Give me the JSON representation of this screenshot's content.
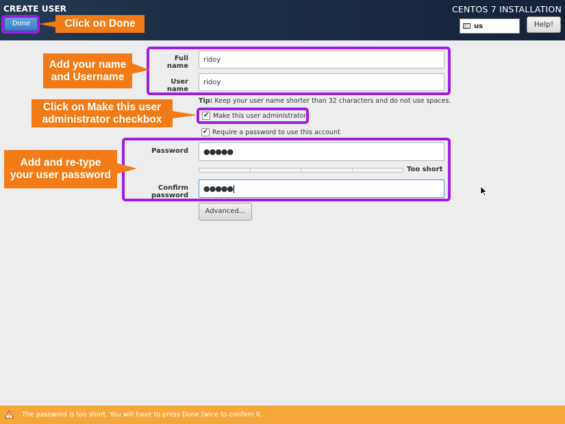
{
  "header": {
    "spoke_title": "CREATE USER",
    "done_label": "Done",
    "product_title": "CENTOS 7 INSTALLATION",
    "keyboard_layout": "us",
    "help_label": "Help!"
  },
  "form": {
    "full_name_label": "Full name",
    "full_name_value": "ridoy",
    "user_name_label": "User name",
    "user_name_value": "ridoy",
    "tip_bold": "Tip:",
    "tip_text": " Keep your user name shorter than 32 characters and do not use spaces.",
    "admin_checkbox_label": "Make this user administrator",
    "admin_checked": true,
    "require_password_label": "Require a password to use this account",
    "require_password_checked": true,
    "password_label": "Password",
    "password_value": "●●●●●",
    "password_strength": 0.0,
    "strength_text": "Too short",
    "confirm_label": "Confirm password",
    "confirm_value": "●●●●●",
    "advanced_label": "Advanced..."
  },
  "warning": {
    "text": "The password is too short. You will have to press Done twice to confirm it."
  },
  "annotations": {
    "highlight_color": "#9d1ee2",
    "callout_color": "#f27b18",
    "done": "Click on Done",
    "name_line1": "Add your name",
    "name_line2": "and Username",
    "admin_line1": "Click on Make this user",
    "admin_line2": "administrator checkbox",
    "password_line1": "Add and re-type",
    "password_line2": "your user password"
  },
  "colors": {
    "header_bg": "#1d2e44",
    "done_button": "#3a7fc7",
    "warning_bar": "#f5a739",
    "focus_border": "#4a90d9"
  }
}
